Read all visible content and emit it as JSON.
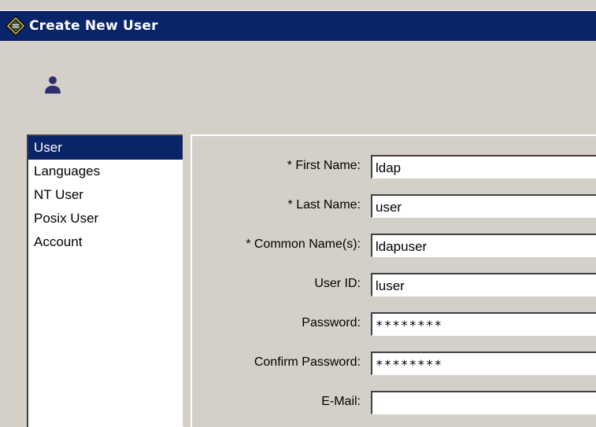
{
  "window": {
    "title": "Create New User"
  },
  "nav": {
    "items": [
      {
        "label": "User",
        "selected": true
      },
      {
        "label": "Languages",
        "selected": false
      },
      {
        "label": "NT User",
        "selected": false
      },
      {
        "label": "Posix User",
        "selected": false
      },
      {
        "label": "Account",
        "selected": false
      }
    ]
  },
  "form": {
    "fields": [
      {
        "label": "* First Name:",
        "value": "ldap"
      },
      {
        "label": "* Last Name:",
        "value": "user"
      },
      {
        "label": "* Common Name(s):",
        "value": "ldapuser"
      },
      {
        "label": "User ID:",
        "value": "luser"
      },
      {
        "label": "Password:",
        "value": "********"
      },
      {
        "label": "Confirm Password:",
        "value": "********"
      },
      {
        "label": "E-Mail:",
        "value": ""
      }
    ]
  },
  "icons": {
    "title": "directory-logo-icon",
    "header": "user-icon"
  },
  "colors": {
    "titlebar": "#0a246a",
    "selection": "#0a246a",
    "face": "#d4d0c8",
    "user_icon": "#2f2f6e"
  }
}
